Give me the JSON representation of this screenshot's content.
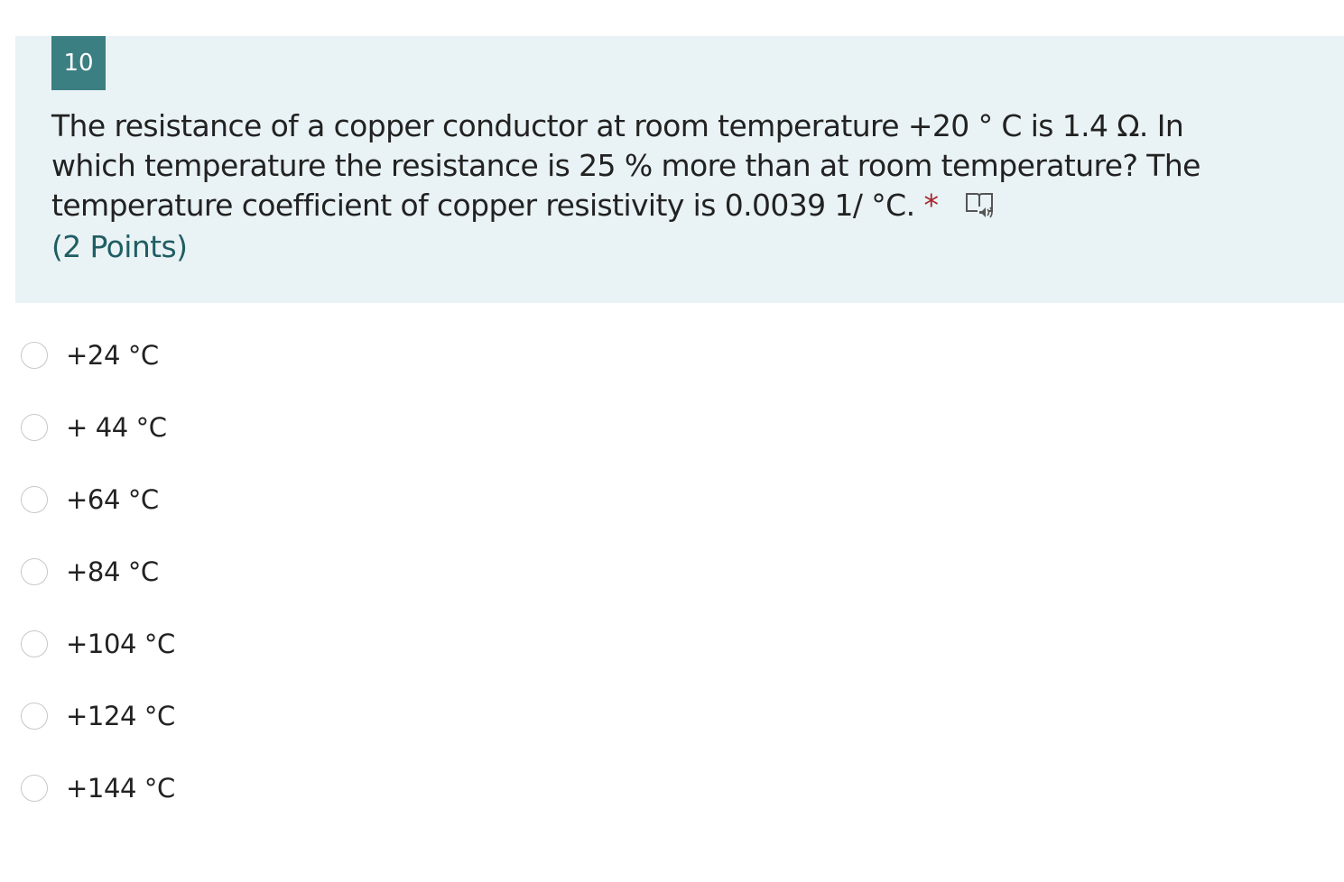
{
  "question": {
    "number": "10",
    "title": "The resistance of a copper conductor at room temperature +20 ° C is 1.4 Ω. In which temperature the resistance is 25 % more than at room temperature? The temperature coefficient of copper resistivity is 0.0039 1/ °C.",
    "required_marker": "*",
    "points": "(2 Points)",
    "reader_icon": "immersive-reader-icon"
  },
  "options": [
    {
      "label": "+24 °C",
      "selected": false
    },
    {
      "label": "+ 44 °C",
      "selected": false
    },
    {
      "label": "+64 °C",
      "selected": false
    },
    {
      "label": "+84 °C",
      "selected": false
    },
    {
      "label": "+104 °C",
      "selected": false
    },
    {
      "label": "+124 °C",
      "selected": false
    },
    {
      "label": "+144 °C",
      "selected": false
    }
  ],
  "colors": {
    "header_bg": "#e9f2f4",
    "number_badge": "#3b7f82",
    "required": "#a4262c",
    "points_text": "#1f5e63"
  }
}
